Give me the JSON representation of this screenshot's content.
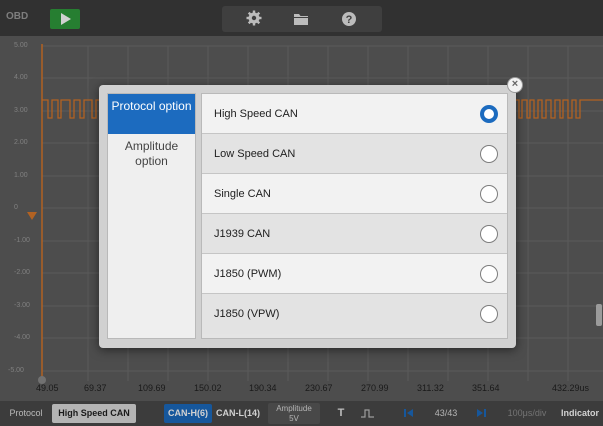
{
  "toolbar": {
    "obd_logo": "OBD",
    "icons": [
      "play-icon",
      "settings-icon",
      "folder-icon",
      "help-icon"
    ]
  },
  "graph": {
    "y_ticks": [
      "5.00",
      "4.00",
      "3.00",
      "2.00",
      "1.00",
      "0",
      "-1.00",
      "-2.00",
      "-3.00",
      "-4.00",
      "-5.00"
    ],
    "x_ticks": [
      "49.05",
      "69.37",
      "109.69",
      "150.02",
      "190.34",
      "230.67",
      "270.99",
      "311.32",
      "351.64",
      "432.29us"
    ]
  },
  "bottom_bar": {
    "protocol_label": "Protocol",
    "protocol_value": "High Speed CAN",
    "can_h": "CAN-H(6)",
    "can_l": "CAN-L(14)",
    "amplitude_label": "Amplitude",
    "amplitude_value": "5V",
    "trigger": "T",
    "page": "43/43",
    "timebase": "100μs/div",
    "indicator": "Indicator"
  },
  "dialog": {
    "categories": [
      "Protocol option",
      "Amplitude option"
    ],
    "options": [
      "High Speed CAN",
      "Low Speed CAN",
      "Single CAN",
      "J1939 CAN",
      "J1850 (PWM)",
      "J1850 (VPW)"
    ],
    "selected": "High Speed CAN",
    "colors": {
      "accent": "#1c6bbf"
    }
  }
}
